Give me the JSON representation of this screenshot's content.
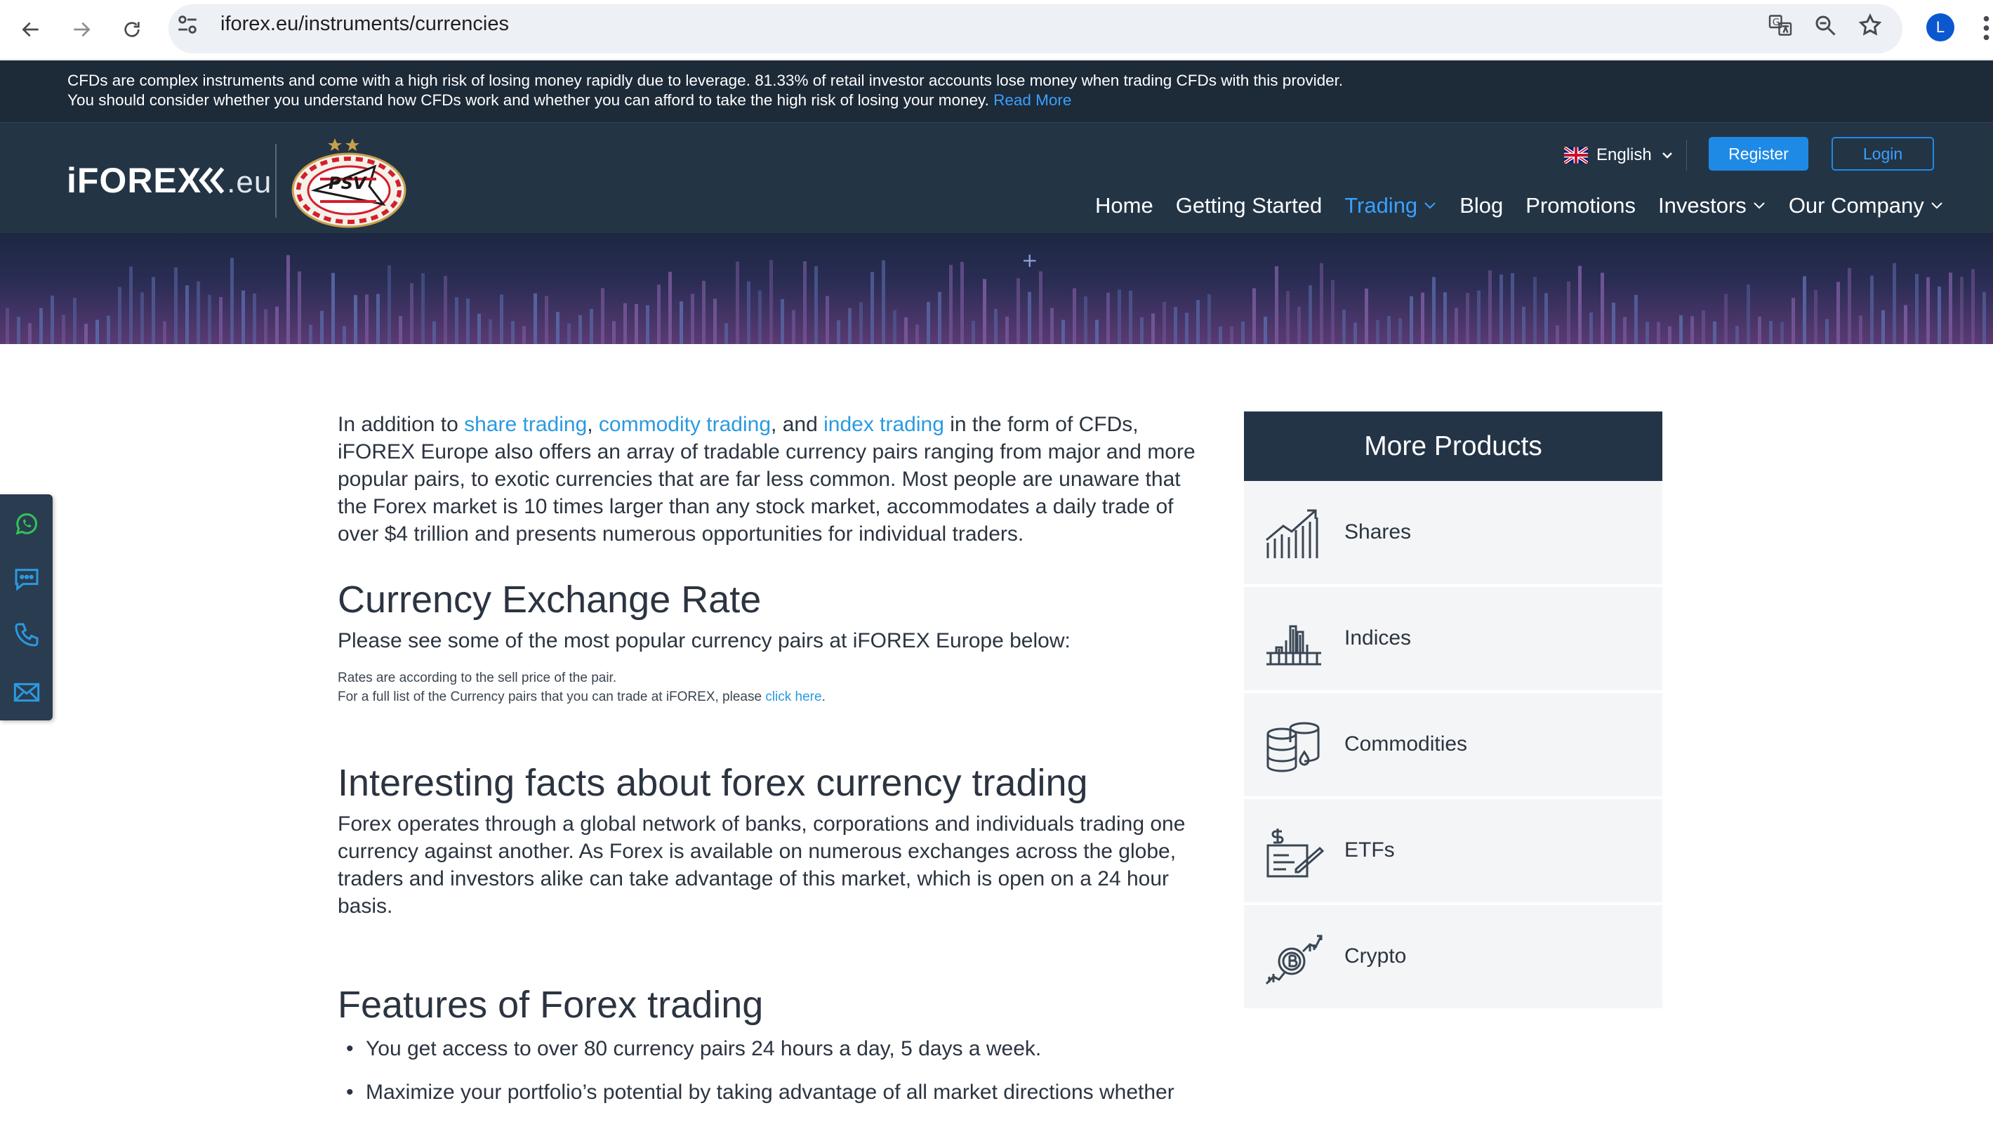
{
  "browser": {
    "url": "iforex.eu/instruments/currencies",
    "avatar_letter": "L"
  },
  "risk_warning": {
    "line1": "CFDs are complex instruments and come with a high risk of losing money rapidly due to leverage. 81.33% of retail investor accounts lose money when trading CFDs with this provider.",
    "line2": "You should consider whether you understand how CFDs work and whether you can afford to take the high risk of losing your money.",
    "read_more": "Read More"
  },
  "header": {
    "logo_main": "iFOREX",
    "logo_suffix": ".eu",
    "language": "English",
    "register": "Register",
    "login": "Login",
    "nav": [
      {
        "label": "Home"
      },
      {
        "label": "Getting Started"
      },
      {
        "label": "Trading"
      },
      {
        "label": "Blog"
      },
      {
        "label": "Promotions"
      },
      {
        "label": "Investors"
      },
      {
        "label": "Our Company"
      }
    ]
  },
  "content": {
    "intro": {
      "t1": "In addition to ",
      "l1": "share trading",
      "t2": ", ",
      "l2": "commodity trading",
      "t3": ", and ",
      "l3": "index trading",
      "t4": " in the form of CFDs, iFOREX Europe also offers an array of tradable currency pairs ranging from major and more popular pairs, to exotic currencies that are far less common. Most people are unaware that the Forex market is 10 times larger than any stock market, accommodates a daily trade of over $4 trillion and presents numerous opportunities for individual traders."
    },
    "rate_heading": "Currency Exchange Rate",
    "rate_text": "Please see some of the most popular currency pairs at iFOREX Europe below:",
    "rate_note1": "Rates are according to the sell price of the pair.",
    "rate_note2_pre": "For a full list of the Currency pairs that you can trade at iFOREX, please ",
    "rate_note2_link": "click here",
    "rate_note2_post": ".",
    "facts_heading": "Interesting facts about forex currency trading",
    "facts_text": "Forex operates through a global network of banks, corporations and individuals trading one currency against another. As Forex is available on numerous exchanges across the globe, traders and investors alike can take advantage of this market, which is open on a 24 hour basis.",
    "features_heading": "Features of Forex trading",
    "features": [
      "You get access to over 80 currency pairs 24 hours a day, 5 days a week.",
      "Maximize your portfolio’s potential by taking advantage of all market directions whether"
    ]
  },
  "more_products": {
    "title": "More Products",
    "items": [
      {
        "label": "Shares",
        "icon": "shares-chart-icon"
      },
      {
        "label": "Indices",
        "icon": "indices-building-icon"
      },
      {
        "label": "Commodities",
        "icon": "commodities-barrels-icon"
      },
      {
        "label": "ETFs",
        "icon": "etfs-document-icon"
      },
      {
        "label": "Crypto",
        "icon": "crypto-coin-icon"
      }
    ]
  },
  "colors": {
    "risk_bg": "#1d2a38",
    "header_bg": "#233445",
    "accent": "#1f8ae6",
    "link": "#2a9ae0"
  }
}
